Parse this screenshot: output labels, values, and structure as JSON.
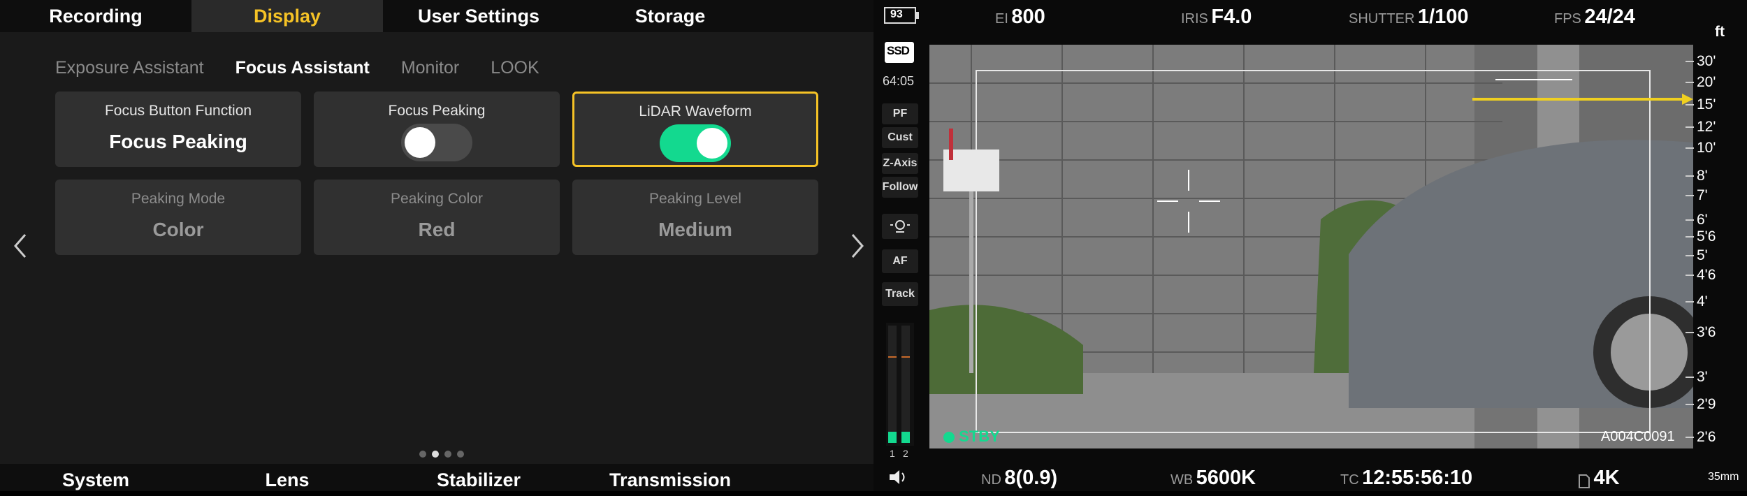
{
  "top_tabs": [
    "Recording",
    "Display",
    "User Settings",
    "Storage"
  ],
  "active_top_tab": "Display",
  "sub_tabs": [
    "Exposure Assistant",
    "Focus Assistant",
    "Monitor",
    "LOOK"
  ],
  "active_sub_tab": "Focus Assistant",
  "cards": {
    "focus_button": {
      "label": "Focus Button Function",
      "value": "Focus Peaking"
    },
    "focus_peaking": {
      "label": "Focus Peaking",
      "toggle": "off"
    },
    "lidar_waveform": {
      "label": "LiDAR Waveform",
      "toggle": "on"
    },
    "peaking_mode": {
      "label": "Peaking Mode",
      "value": "Color"
    },
    "peaking_color": {
      "label": "Peaking Color",
      "value": "Red"
    },
    "peaking_level": {
      "label": "Peaking Level",
      "value": "Medium"
    }
  },
  "page_indicator": {
    "count": 4,
    "active": 2
  },
  "bottom_tabs": [
    "System",
    "Lens",
    "Stabilizer",
    "Transmission"
  ],
  "monitor": {
    "battery": "93",
    "media": "SSD",
    "remaining": "64:05",
    "ei": {
      "label": "EI",
      "value": "800"
    },
    "iris": {
      "label": "IRIS",
      "value": "F4.0"
    },
    "shutter": {
      "label": "SHUTTER",
      "value": "1/100"
    },
    "fps": {
      "label": "FPS",
      "value": "24/24"
    },
    "side_buttons": [
      "PF",
      "Cust",
      "Z-Axis",
      "Follow",
      "AF",
      "Track"
    ],
    "audio_channels": [
      "1",
      "2"
    ],
    "status": "STBY",
    "clip_name": "A004C0091",
    "unit": "ft",
    "distance_scale": [
      "30'",
      "20'",
      "15'",
      "12'",
      "10'",
      "8'",
      "7'",
      "6'",
      "5'6",
      "5'",
      "4'6",
      "4'",
      "3'6",
      "3'",
      "2'9",
      "2'6"
    ],
    "focal_length": "35mm",
    "nd": {
      "label": "ND",
      "value": "8(0.9)"
    },
    "wb": {
      "label": "WB",
      "value": "5600K"
    },
    "tc": {
      "label": "TC",
      "value": "12:55:56:10"
    },
    "resolution": "4K"
  },
  "colors": {
    "accent": "#f6c326",
    "toggle_on": "#13d98f",
    "status": "#13d98f"
  },
  "icons": [
    "chevron-left-icon",
    "chevron-right-icon",
    "battery-icon",
    "ssd-icon",
    "mic-icon",
    "speaker-icon",
    "sd-card-icon",
    "af-marker-icon"
  ]
}
